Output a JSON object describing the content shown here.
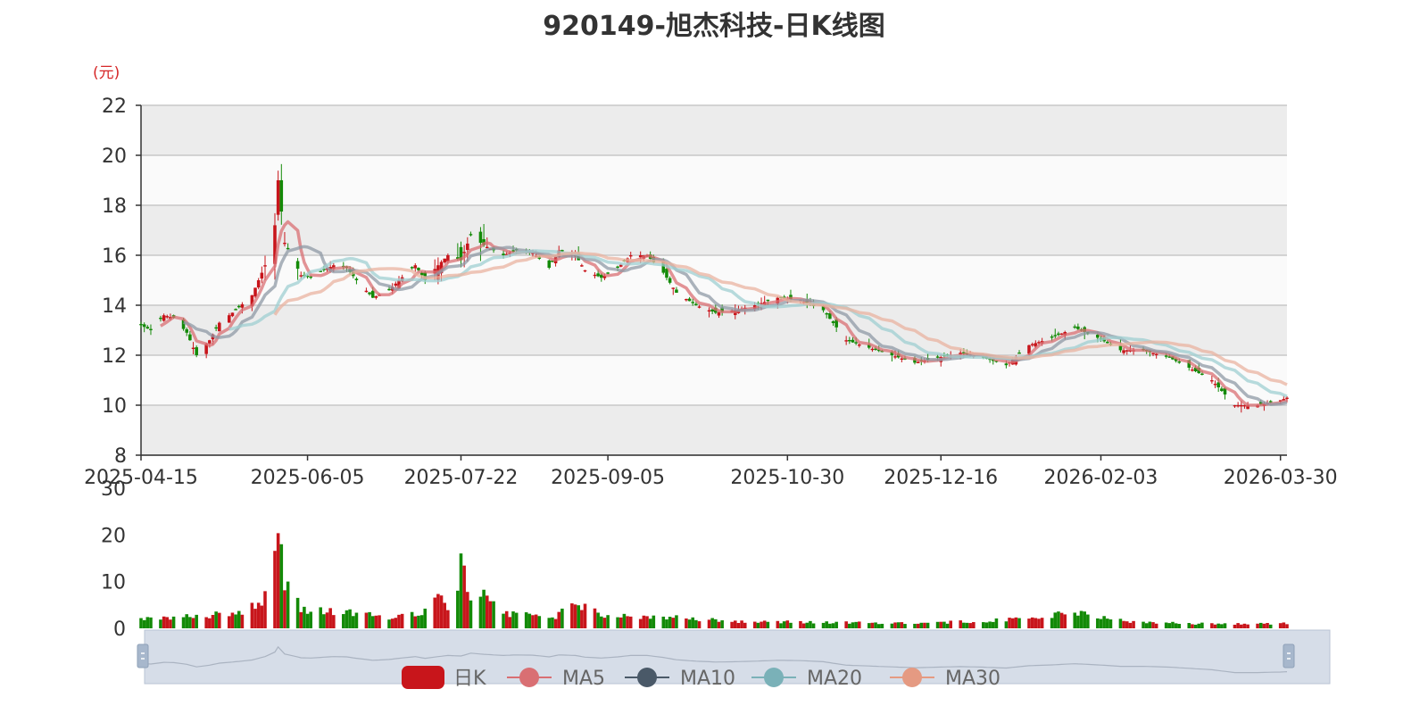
{
  "title": "920149-旭杰科技-日K线图",
  "unit_label": "(元)",
  "colors": {
    "up": "#c8151b",
    "down": "#138a07",
    "ma5": "#d96f73",
    "ma10": "#8f9aa6",
    "ma20": "#9fcfd1",
    "ma30": "#e9b3a0",
    "band_dark": "#ececec",
    "band_light": "#fafafa",
    "slider": "#d6dde8"
  },
  "legend": [
    {
      "label": "日K",
      "icon": "candle-legend-icon",
      "color": "#c8151b"
    },
    {
      "label": "MA5",
      "icon": "line-dot-legend-icon",
      "color": "#d96f73"
    },
    {
      "label": "MA10",
      "icon": "line-dot-legend-icon",
      "color": "#4a5968"
    },
    {
      "label": "MA20",
      "icon": "line-dot-legend-icon",
      "color": "#7ab1b8"
    },
    {
      "label": "MA30",
      "icon": "line-dot-legend-icon",
      "color": "#e59a82"
    }
  ],
  "chart_data": {
    "type": "candlestick",
    "price_axis": {
      "ticks": [
        "8",
        "10",
        "12",
        "14",
        "16",
        "18",
        "20",
        "22"
      ],
      "ylim": [
        8,
        22
      ]
    },
    "volume_axis": {
      "ticks": [
        "0",
        "10",
        "20",
        "30"
      ],
      "ylim": [
        0,
        30
      ]
    },
    "x_ticks": [
      "2025-04-15",
      "2025-06-05",
      "2025-07-22",
      "2025-09-05",
      "2025-10-30",
      "2025-12-16",
      "2026-02-03",
      "2026-03-30"
    ],
    "xlim": [
      "2025-04-15",
      "2026-04-01"
    ],
    "price_anchors": [
      [
        "2025-04-15",
        13.2
      ],
      [
        "2025-04-18",
        13.0
      ],
      [
        "2025-04-22",
        13.6
      ],
      [
        "2025-04-25",
        13.5
      ],
      [
        "2025-04-29",
        12.9
      ],
      [
        "2025-05-02",
        12.0
      ],
      [
        "2025-05-06",
        12.6
      ],
      [
        "2025-05-09",
        13.3
      ],
      [
        "2025-05-14",
        13.8
      ],
      [
        "2025-05-19",
        14.4
      ],
      [
        "2025-05-23",
        15.6
      ],
      [
        "2025-05-26",
        17.2
      ],
      [
        "2025-05-27",
        19.0
      ],
      [
        "2025-05-29",
        16.5
      ],
      [
        "2025-06-03",
        15.2
      ],
      [
        "2025-06-06",
        15.1
      ],
      [
        "2025-06-10",
        15.4
      ],
      [
        "2025-06-13",
        15.6
      ],
      [
        "2025-06-17",
        15.5
      ],
      [
        "2025-06-20",
        15.0
      ],
      [
        "2025-06-25",
        14.3
      ],
      [
        "2025-06-30",
        14.6
      ],
      [
        "2025-07-03",
        15.0
      ],
      [
        "2025-07-08",
        15.6
      ],
      [
        "2025-07-11",
        15.0
      ],
      [
        "2025-07-15",
        15.6
      ],
      [
        "2025-07-18",
        16.0
      ],
      [
        "2025-07-22",
        15.8
      ],
      [
        "2025-07-25",
        16.8
      ],
      [
        "2025-07-29",
        16.4
      ],
      [
        "2025-08-04",
        16.0
      ],
      [
        "2025-08-08",
        16.2
      ],
      [
        "2025-08-13",
        16.1
      ],
      [
        "2025-08-18",
        15.5
      ],
      [
        "2025-08-21",
        16.2
      ],
      [
        "2025-08-26",
        16.0
      ],
      [
        "2025-08-29",
        15.4
      ],
      [
        "2025-09-03",
        15.1
      ],
      [
        "2025-09-08",
        15.5
      ],
      [
        "2025-09-12",
        16.0
      ],
      [
        "2025-09-17",
        16.0
      ],
      [
        "2025-09-22",
        15.3
      ],
      [
        "2025-09-26",
        14.5
      ],
      [
        "2025-10-02",
        14.0
      ],
      [
        "2025-10-08",
        13.7
      ],
      [
        "2025-10-14",
        13.8
      ],
      [
        "2025-10-20",
        14.0
      ],
      [
        "2025-10-27",
        14.3
      ],
      [
        "2025-11-03",
        14.2
      ],
      [
        "2025-11-10",
        13.8
      ],
      [
        "2025-11-17",
        12.6
      ],
      [
        "2025-11-24",
        12.3
      ],
      [
        "2025-12-01",
        12.0
      ],
      [
        "2025-12-08",
        11.7
      ],
      [
        "2025-12-15",
        11.9
      ],
      [
        "2025-12-22",
        12.1
      ],
      [
        "2025-12-29",
        11.9
      ],
      [
        "2026-01-05",
        11.6
      ],
      [
        "2026-01-12",
        12.4
      ],
      [
        "2026-01-19",
        12.7
      ],
      [
        "2026-01-26",
        13.1
      ],
      [
        "2026-02-02",
        12.7
      ],
      [
        "2026-02-09",
        12.2
      ],
      [
        "2026-02-16",
        12.2
      ],
      [
        "2026-02-24",
        11.9
      ],
      [
        "2026-03-02",
        11.5
      ],
      [
        "2026-03-09",
        11.0
      ],
      [
        "2026-03-16",
        10.0
      ],
      [
        "2026-03-23",
        10.0
      ],
      [
        "2026-03-30",
        10.2
      ],
      [
        "2026-04-01",
        10.3
      ]
    ],
    "volume_anchors": [
      [
        "2025-04-15",
        2.2
      ],
      [
        "2025-05-01",
        2.5
      ],
      [
        "2025-05-15",
        3.5
      ],
      [
        "2025-05-22",
        6.0
      ],
      [
        "2025-05-26",
        14.5
      ],
      [
        "2025-05-27",
        21.0
      ],
      [
        "2025-05-28",
        16.0
      ],
      [
        "2025-05-29",
        10.5
      ],
      [
        "2025-06-03",
        4.0
      ],
      [
        "2025-06-15",
        3.5
      ],
      [
        "2025-06-30",
        2.5
      ],
      [
        "2025-07-10",
        3.5
      ],
      [
        "2025-07-15",
        7.5
      ],
      [
        "2025-07-18",
        3.5
      ],
      [
        "2025-07-22",
        13.0
      ],
      [
        "2025-07-25",
        7.5
      ],
      [
        "2025-07-29",
        9.5
      ],
      [
        "2025-08-05",
        3.0
      ],
      [
        "2025-08-20",
        2.5
      ],
      [
        "2025-08-26",
        5.5
      ],
      [
        "2025-09-05",
        2.5
      ],
      [
        "2025-09-20",
        2.5
      ],
      [
        "2025-10-15",
        1.5
      ],
      [
        "2025-11-15",
        1.2
      ],
      [
        "2025-12-15",
        1.2
      ],
      [
        "2026-01-12",
        2.0
      ],
      [
        "2026-01-26",
        3.5
      ],
      [
        "2026-02-10",
        1.5
      ],
      [
        "2026-03-01",
        1.0
      ],
      [
        "2026-04-01",
        1.0
      ]
    ]
  }
}
